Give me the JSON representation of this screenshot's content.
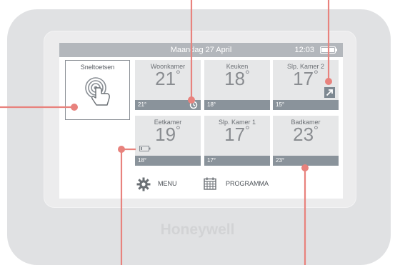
{
  "status_bar": {
    "date": "Maandag 27 April",
    "time": "12:03"
  },
  "shortcut": {
    "label": "Sneltoetsen",
    "icon": "touch-tap-icon"
  },
  "zones": [
    {
      "name": "Woonkamer",
      "temp": "21",
      "setpoint": "21°",
      "icon": "clock-icon"
    },
    {
      "name": "Keuken",
      "temp": "18",
      "setpoint": "18°"
    },
    {
      "name": "Slp. Kamer 2",
      "temp": "17",
      "setpoint": "15°",
      "icon": "trend-up-icon"
    },
    {
      "name": "Eetkamer",
      "temp": "19",
      "setpoint": "18°",
      "icon": "low-battery-icon"
    },
    {
      "name": "Slp. Kamer 1",
      "temp": "17",
      "setpoint": "17°"
    },
    {
      "name": "Badkamer",
      "temp": "23",
      "setpoint": "23°"
    }
  ],
  "degree_symbol": "°",
  "nav": {
    "menu_label": "MENU",
    "program_label": "PROGRAMMA"
  },
  "brand": "Honeywell",
  "colors": {
    "callout": "#e8827d",
    "status_bar": "#b3b7bc",
    "zone_bg": "#e6e7e8",
    "zone_bar": "#8a939b"
  }
}
